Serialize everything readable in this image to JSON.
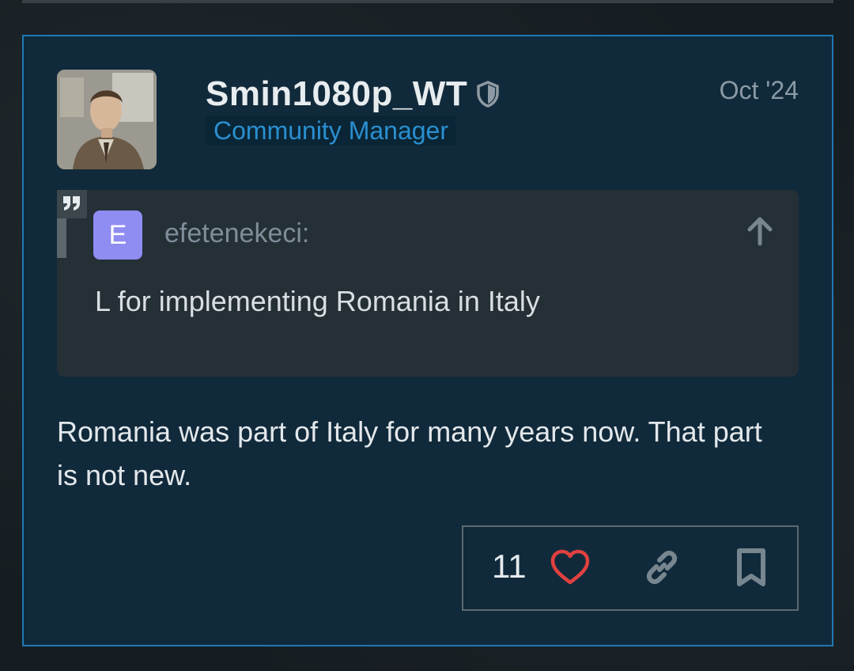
{
  "post": {
    "username": "Smin1080p_WT",
    "user_title": "Community Manager",
    "date": "Oct '24",
    "quote": {
      "avatar_letter": "E",
      "author": "efetenekeci:",
      "text": "L for implementing Romania in Italy"
    },
    "body": "Romania was part of Italy for many years now. That part is not new.",
    "likes": "11"
  },
  "icons": {
    "moderator": "shield-icon",
    "quote": "quote-mark-icon",
    "jump": "arrow-up-icon",
    "like": "heart-icon",
    "share": "link-icon",
    "bookmark": "bookmark-icon"
  },
  "colors": {
    "post_background": "#112a3b",
    "post_border": "#1f78b5",
    "title_text": "#2a8fd0",
    "quote_background": "#252f36",
    "quote_avatar": "#8f8cf2",
    "heart": "#e0413f"
  }
}
